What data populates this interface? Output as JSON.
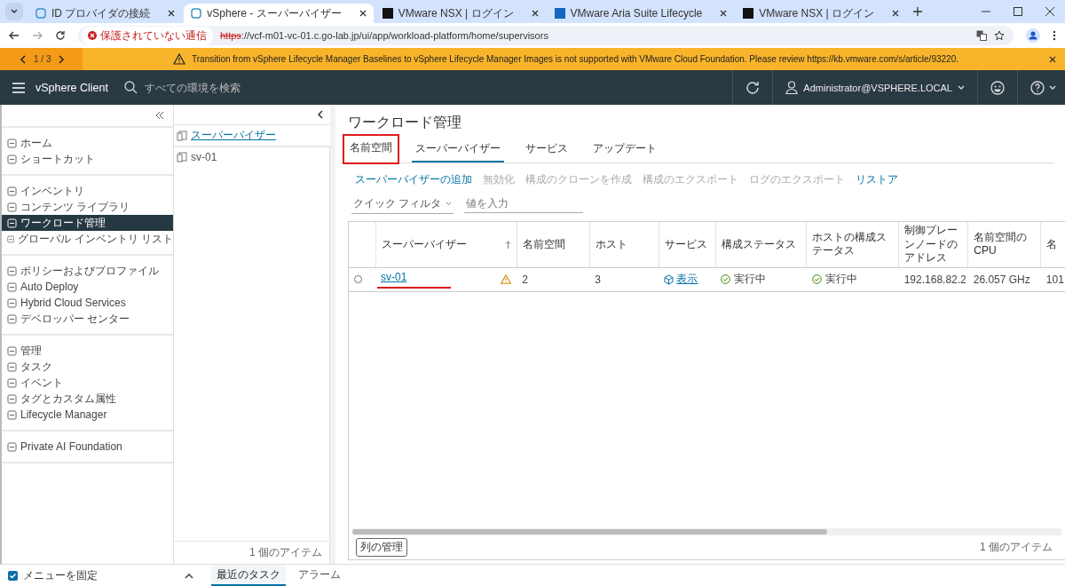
{
  "browser_tabs": [
    {
      "title": "ID プロバイダの接続",
      "selected": false
    },
    {
      "title": "vSphere - スーパーバイザー",
      "selected": true
    },
    {
      "title": "VMware NSX | ログイン",
      "selected": false
    },
    {
      "title": "VMware Aria Suite Lifecycle",
      "selected": false
    },
    {
      "title": "VMware NSX | ログイン",
      "selected": false
    }
  ],
  "address_bar": {
    "security": "保護されていない通信",
    "scheme": "https",
    "url": "://vcf-m01-vc-01.c.go-lab.jp/ui/app/workload-platform/home/supervisors"
  },
  "banner": {
    "pager": "1 / 3",
    "message": "Transition from vSphere Lifecycle Manager Baselines to vSphere Lifecycle Manager Images is not supported with VMware Cloud Foundation. Please review https://kb.vmware.com/s/article/93220."
  },
  "header": {
    "app_name": "vSphere Client",
    "search_placeholder": "すべての環境を検索",
    "user": "Administrator@VSPHERE.LOCAL"
  },
  "sidebar": {
    "groups": [
      [
        {
          "label": "ホーム",
          "selected": false
        },
        {
          "label": "ショートカット",
          "selected": false
        }
      ],
      [
        {
          "label": "インベントリ",
          "selected": false
        },
        {
          "label": "コンテンツ ライブラリ",
          "selected": false
        },
        {
          "label": "ワークロード管理",
          "selected": true
        },
        {
          "label": "グローバル インベントリ リスト",
          "selected": false
        }
      ],
      [
        {
          "label": "ポリシーおよびプロファイル",
          "selected": false
        },
        {
          "label": "Auto Deploy",
          "selected": false
        },
        {
          "label": "Hybrid Cloud Services",
          "selected": false
        },
        {
          "label": "デベロッパー センター",
          "selected": false
        }
      ],
      [
        {
          "label": "管理",
          "selected": false
        },
        {
          "label": "タスク",
          "selected": false
        },
        {
          "label": "イベント",
          "selected": false
        },
        {
          "label": "タグとカスタム属性",
          "selected": false
        },
        {
          "label": "Lifecycle Manager",
          "selected": false
        }
      ],
      [
        {
          "label": "Private AI Foundation",
          "selected": false
        }
      ]
    ],
    "pin_menu": {
      "label": "メニューを固定",
      "checked": true
    }
  },
  "tree": {
    "heading": "スーパーバイザー",
    "items": [
      {
        "label": "sv-01"
      }
    ],
    "footer": "1 個のアイテム"
  },
  "main": {
    "title": "ワークロード管理",
    "tabs": [
      {
        "label": "名前空間",
        "selected": false,
        "highlighted": true
      },
      {
        "label": "スーパーバイザー",
        "selected": true,
        "highlighted": false
      },
      {
        "label": "サービス",
        "selected": false,
        "highlighted": false
      },
      {
        "label": "アップデート",
        "selected": false,
        "highlighted": false
      }
    ],
    "actions": [
      {
        "label": "スーパーバイザーの追加",
        "disabled": false
      },
      {
        "label": "無効化",
        "disabled": true
      },
      {
        "label": "構成のクローンを作成",
        "disabled": true
      },
      {
        "label": "構成のエクスポート",
        "disabled": true
      },
      {
        "label": "ログのエクスポート",
        "disabled": true
      },
      {
        "label": "リストア",
        "disabled": false
      }
    ],
    "filter": {
      "label": "クイック フィルタ",
      "placeholder": "値を入力"
    },
    "table": {
      "columns": [
        "スーパーバイザー",
        "名前空間",
        "ホスト",
        "サービス",
        "構成ステータス",
        "ホストの構成ステータス",
        "制御プレーンノードのアドレス",
        "名前空間の CPU",
        "名"
      ],
      "rows": [
        {
          "selected": false,
          "supervisor": "sv-01",
          "underlined": true,
          "warning": true,
          "namespaces": "2",
          "hosts": "3",
          "services": "表示",
          "config_status": "実行中",
          "host_config_status": "実行中",
          "control_plane": "192.168.82.2",
          "cpu": "26.057 GHz",
          "column_9": "101"
        }
      ]
    },
    "manage_columns": "列の管理",
    "footer": "1 個のアイテム"
  },
  "bottom_tabs": [
    {
      "label": "最近のタスク",
      "selected": true
    },
    {
      "label": "アラーム",
      "selected": false
    }
  ]
}
